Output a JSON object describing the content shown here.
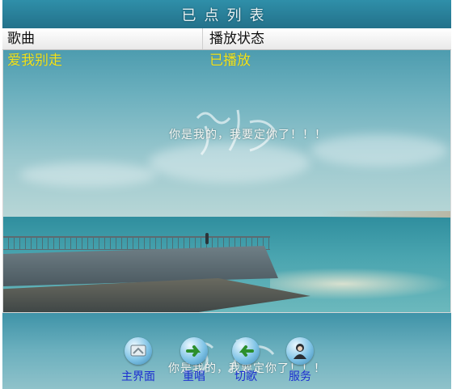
{
  "window": {
    "title": "已点列表"
  },
  "table": {
    "headers": [
      "歌曲",
      "播放状态"
    ],
    "rows": [
      {
        "song": "爱我别走",
        "status": "已播放"
      }
    ]
  },
  "overlay": {
    "caption": "你是我的，我要定你了！！！"
  },
  "toolbar": {
    "main_label": "主界面",
    "replay_label": "重唱",
    "next_label": "切歌",
    "service_label": "服务"
  },
  "colors": {
    "accent_text": "#f2e41e",
    "toolbar_label": "#1d2fd1"
  }
}
